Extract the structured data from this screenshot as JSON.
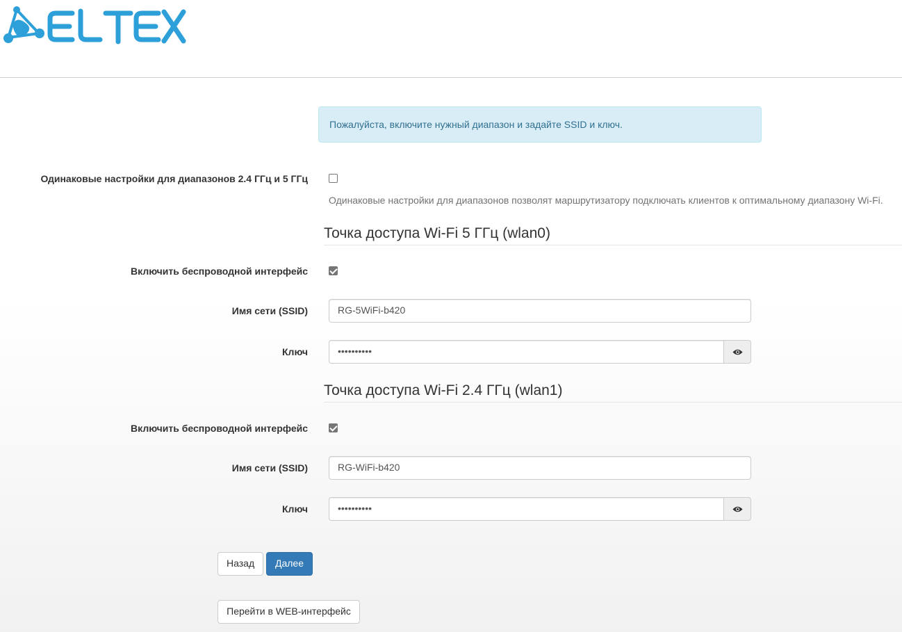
{
  "header": {
    "logo_text": "ELTEX"
  },
  "alert": {
    "text": "Пожалуйста, включите нужный диапазон и задайте SSID и ключ."
  },
  "same_settings": {
    "label": "Одинаковые настройки для диапазонов 2.4 ГГц и 5 ГГц",
    "checked": false,
    "help": "Одинаковые настройки для диапазонов позволят маршрутизатору подключать клиентов к оптимальному диапазону Wi-Fi."
  },
  "wlan0": {
    "title": "Точка доступа Wi-Fi 5 ГГц (wlan0)",
    "enable_label": "Включить беспроводной интерфейс",
    "enabled": true,
    "ssid_label": "Имя сети (SSID)",
    "ssid_value": "RG-5WiFi-b420",
    "key_label": "Ключ",
    "key_value": "••••••••••"
  },
  "wlan1": {
    "title": "Точка доступа Wi-Fi 2.4 ГГц (wlan1)",
    "enable_label": "Включить беспроводной интерфейс",
    "enabled": true,
    "ssid_label": "Имя сети (SSID)",
    "ssid_value": "RG-WiFi-b420",
    "key_label": "Ключ",
    "key_value": "••••••••••"
  },
  "buttons": {
    "back": "Назад",
    "next": "Далее",
    "web": "Перейти в WEB-интерфейс"
  },
  "colors": {
    "logo_blue": "#2d9fd9",
    "primary": "#337ab7",
    "alert_bg": "#d9edf7",
    "alert_text": "#31708f"
  },
  "icons": {
    "logo": "eltex-network-icon",
    "show_password": "eye-icon"
  }
}
